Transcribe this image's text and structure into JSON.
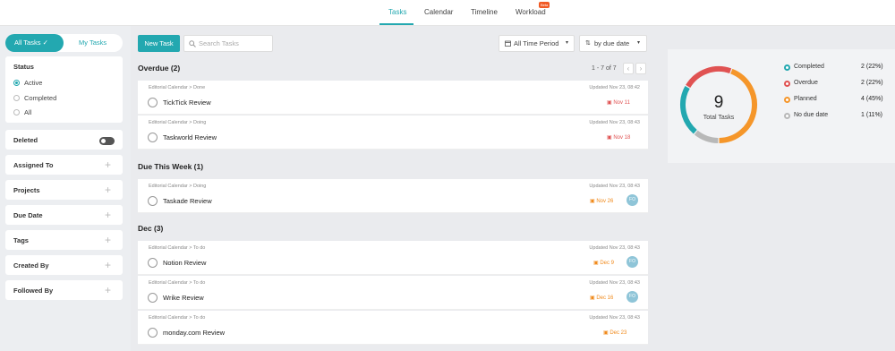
{
  "nav": {
    "tabs": [
      "Tasks",
      "Calendar",
      "Timeline",
      "Workload"
    ],
    "beta_badge": "Beta"
  },
  "sidebar": {
    "toggle": {
      "all_tasks": "All Tasks",
      "my_tasks": "My Tasks"
    },
    "status": {
      "title": "Status",
      "options": [
        "Active",
        "Completed",
        "All"
      ],
      "selected": "Active"
    },
    "deleted": {
      "label": "Deleted",
      "enabled": false
    },
    "filters": [
      "Assigned To",
      "Projects",
      "Due Date",
      "Tags",
      "Created By",
      "Followed By"
    ]
  },
  "toolbar": {
    "new_task": "New Task",
    "search_placeholder": "Search Tasks",
    "period": "All Time Period",
    "sort": "by due date"
  },
  "pager": {
    "text": "1 - 7 of 7"
  },
  "sections": [
    {
      "title": "Overdue (2)",
      "tasks": [
        {
          "breadcrumb": "Editorial Calendar > Done",
          "name": "TickTick Review",
          "updated": "Updated Nov 23, 08:42",
          "due": "Nov 11",
          "due_color": "red",
          "assignee": ""
        },
        {
          "breadcrumb": "Editorial Calendar > Doing",
          "name": "Taskworld Review",
          "updated": "Updated Nov 23, 08:43",
          "due": "Nov 18",
          "due_color": "red",
          "assignee": ""
        }
      ]
    },
    {
      "title": "Due This Week (1)",
      "tasks": [
        {
          "breadcrumb": "Editorial Calendar > Doing",
          "name": "Taskade Review",
          "updated": "Updated Nov 23, 08:43",
          "due": "Nov 26",
          "due_color": "orange",
          "assignee": "FO"
        }
      ]
    },
    {
      "title": "Dec (3)",
      "tasks": [
        {
          "breadcrumb": "Editorial Calendar > To do",
          "name": "Notion Review",
          "updated": "Updated Nov 23, 08:43",
          "due": "Dec 9",
          "due_color": "orange",
          "assignee": "FO"
        },
        {
          "breadcrumb": "Editorial Calendar > To do",
          "name": "Wrike Review",
          "updated": "Updated Nov 23, 08:43",
          "due": "Dec 16",
          "due_color": "orange",
          "assignee": "FO"
        },
        {
          "breadcrumb": "Editorial Calendar > To do",
          "name": "monday.com Review",
          "updated": "Updated Nov 23, 08:43",
          "due": "Dec 23",
          "due_color": "orange",
          "assignee": ""
        }
      ]
    }
  ],
  "stats": {
    "total": "9",
    "total_label": "Total Tasks",
    "legend": [
      {
        "label": "Completed",
        "count": 2,
        "pct": "(22%)",
        "color": "#23a8b0"
      },
      {
        "label": "Overdue",
        "count": 2,
        "pct": "(22%)",
        "color": "#e05252"
      },
      {
        "label": "Planned",
        "count": 4,
        "pct": "(45%)",
        "color": "#f5962a"
      },
      {
        "label": "No due date",
        "count": 1,
        "pct": "(11%)",
        "color": "#b8b8b8"
      }
    ]
  }
}
